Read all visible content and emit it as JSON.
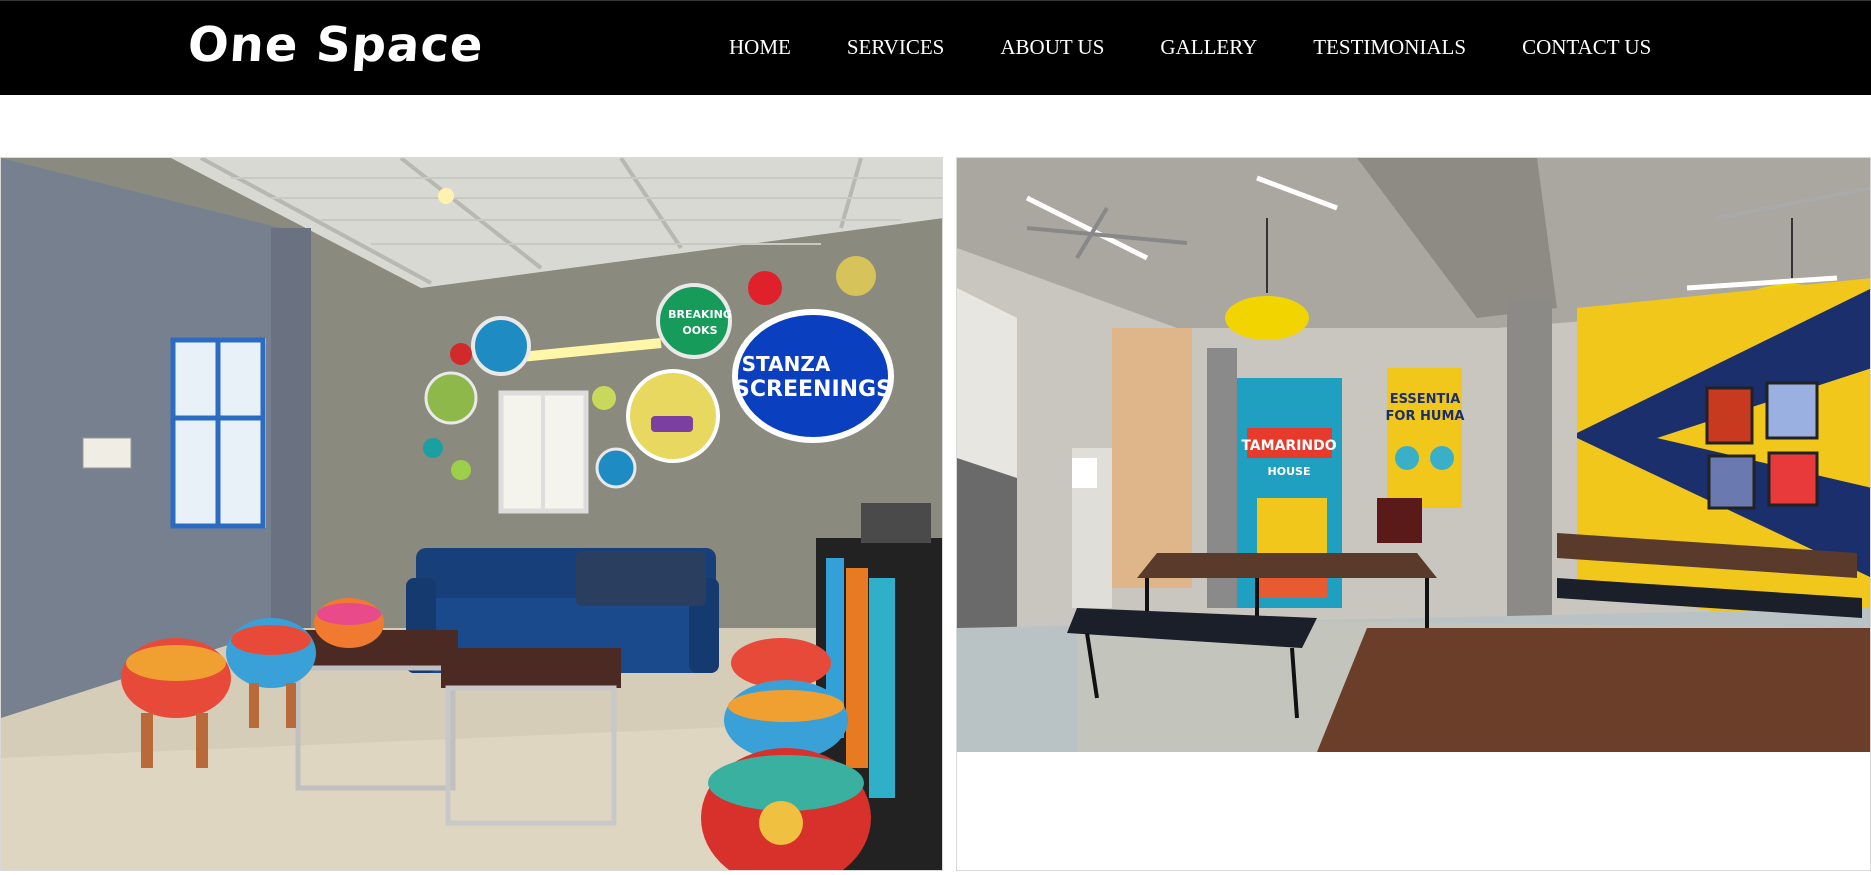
{
  "header": {
    "logo": "One Space",
    "nav": [
      {
        "label": "HOME"
      },
      {
        "label": "SERVICES"
      },
      {
        "label": "ABOUT US"
      },
      {
        "label": "GALLERY"
      },
      {
        "label": "TESTIMONIALS"
      },
      {
        "label": "CONTACT US"
      }
    ]
  },
  "gallery": {
    "left_photo": {
      "signs": {
        "stanza_1": "STANZA",
        "stanza_2": "SCREENINGS",
        "breaking": "BREAKING",
        "books": "OOKS"
      }
    },
    "right_photo": {
      "signs": {
        "tamarindo_1": "TAMARINDO",
        "tamarindo_2": "HOUSE",
        "essential_1": "ESSENTIA",
        "essential_2": "FOR HUMA"
      }
    }
  },
  "colors": {
    "nav_bg": "#000000",
    "nav_text": "#ffffff",
    "page_bg": "#ffffff",
    "sign_blue": "#0a3fbf",
    "wall_yellow": "#f2c71c",
    "wall_navy": "#1a2f6b"
  }
}
